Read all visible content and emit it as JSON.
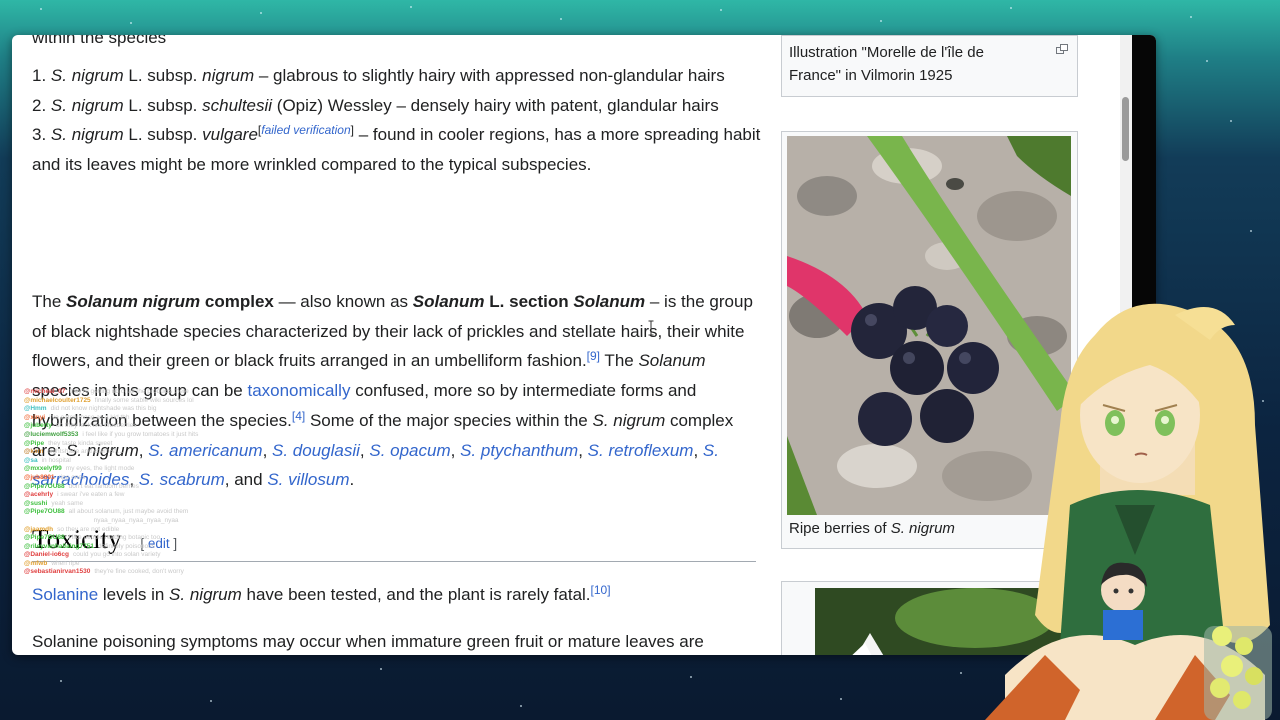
{
  "article": {
    "top_cut": "within the species",
    "list": [
      {
        "num": "1.",
        "genus": "S. nigrum",
        "auth": "L. subsp.",
        "sub": "nigrum",
        "rest": "– glabrous to slightly hairy with appressed non-glandular hairs"
      },
      {
        "num": "2.",
        "genus": "S. nigrum",
        "auth": "L. subsp.",
        "sub": "schultesii",
        "rest": "(Opiz) Wessley – densely hairy with patent, glandular hairs"
      },
      {
        "num": "3.",
        "genus": "S. nigrum",
        "auth": "L. subsp.",
        "sub": "vulgare",
        "fv": "failed verification",
        "rest": " – found in cooler regions, has a more spreading habit and its leaves might be more wrinkled compared to the typical subspecies."
      }
    ],
    "p1": {
      "t1": "The ",
      "b1": "Solanum nigrum",
      "b1b": " complex",
      "t2": " — also known as ",
      "b2": "Solanum",
      "b2b": " L. section ",
      "b3": "Solanum",
      "t3": " – is the group of black nightshade species characterized by their lack of prickles and stellate hairs, their white flowers, and their green or black fruits arranged in an umbelliform fashion.",
      "ref9": "[9]",
      "t4": " The ",
      "i1": "Solanum",
      "t5": " species in this group can be ",
      "link1": "taxonomically",
      "t6": " confused, more so by intermediate forms and hybridization between the species.",
      "ref4": "[4]",
      "t7": " Some of the major species within the ",
      "i2": "S. nigrum",
      "t8": " complex are: ",
      "sp1": "S. nigrum",
      "sp2": "S. americanum",
      "sp3": "S. douglasii",
      "sp4": "S. opacum",
      "sp5": "S. ptychanthum",
      "sp6": "S. retroflexum",
      "sp7": "S. sarrachoides",
      "sp8": "S. scabrum",
      "and": ", and ",
      "sp9": "S. villosum",
      "end": "."
    },
    "heading": "Toxicity",
    "edit_open": "[ ",
    "edit_label": "edit",
    "edit_close": " ]",
    "p2": {
      "link": "Solanine",
      "t1": " levels in ",
      "i": "S. nigrum",
      "t2": " have been tested, and the plant is rarely fatal.",
      "ref": "[10]"
    },
    "p3": {
      "t": "Solanine poisoning symptoms may occur when immature green fruit or mature leaves are"
    }
  },
  "sidebar": {
    "fig1_caption": "Illustration \"Morelle de l'île de France\" in Vilmorin 1925",
    "fig2_caption_pre": "Ripe berries of ",
    "fig2_caption_ital": "S. nigrum"
  },
  "chat": [
    {
      "user": "@micheal_07",
      "msg": "they're getting rid of all the products there",
      "color": "#e05050"
    },
    {
      "user": "@michaelcoulter1725",
      "msg": "finally some stable wiki sources lol",
      "color": "#e0a030"
    },
    {
      "user": "@Hmm",
      "msg": "did not know nightshade was this big",
      "color": "#40c0c0"
    },
    {
      "user": "@xinyi",
      "msg": "i've eaten those as a kid tbh",
      "color": "#f07040"
    },
    {
      "user": "@juberty",
      "msg": "do they look like blueberries",
      "color": "#40c040"
    },
    {
      "user": "@luciemwolf5353",
      "msg": "i feel like if you grow tomatoes it just hits",
      "color": "#40a040"
    },
    {
      "user": "@Pipe",
      "msg": "they taste kinda sweet",
      "color": "#40c040"
    },
    {
      "user": "@kxm",
      "msg": "nightshade and chemist ...",
      "color": "#c08030"
    },
    {
      "user": "@sa",
      "msg": "in hospital",
      "color": "#40c0c0"
    },
    {
      "user": "@mxxelyf99",
      "msg": "my eyes, the light mode",
      "color": "#40c040"
    },
    {
      "user": "@jub8891",
      "msg": "ripe ones",
      "color": "#f06030"
    },
    {
      "user": "@Pipe7OU88",
      "msg": "don't eat random berries",
      "color": "#40c040"
    },
    {
      "user": "@acehrly",
      "msg": "i swear i've eaten a few",
      "color": "#e04040"
    },
    {
      "user": "@sushi",
      "msg": "yeah same",
      "color": "#40c040"
    },
    {
      "user": "@Pipe7OU88",
      "msg": "all about solanum, just maybe avoid them",
      "color": "#40c040"
    },
    {
      "user": "@1992_Space_Movie",
      "msg": "nyaa_nyaa_nyaa_nyaa_nyaa",
      "color": "#ffffff"
    },
    {
      "user": "@jaamdh",
      "msg": "so they are not edible",
      "color": "#e0a030"
    },
    {
      "user": "@Pipe7OU88",
      "msg": "i like people reading botanic too",
      "color": "#40c040"
    },
    {
      "user": "@rileyvanhallaing7751",
      "msg": "definitely poisonous",
      "color": "#40c040"
    },
    {
      "user": "@Daniel-io6cg",
      "msg": "could you go into solan variety",
      "color": "#e04040"
    },
    {
      "user": "@mfwb",
      "msg": "when ripe",
      "color": "#e0a030"
    },
    {
      "user": "@sebastianirvan1530",
      "msg": "they're fine cooked, don't worry",
      "color": "#e04040"
    }
  ]
}
